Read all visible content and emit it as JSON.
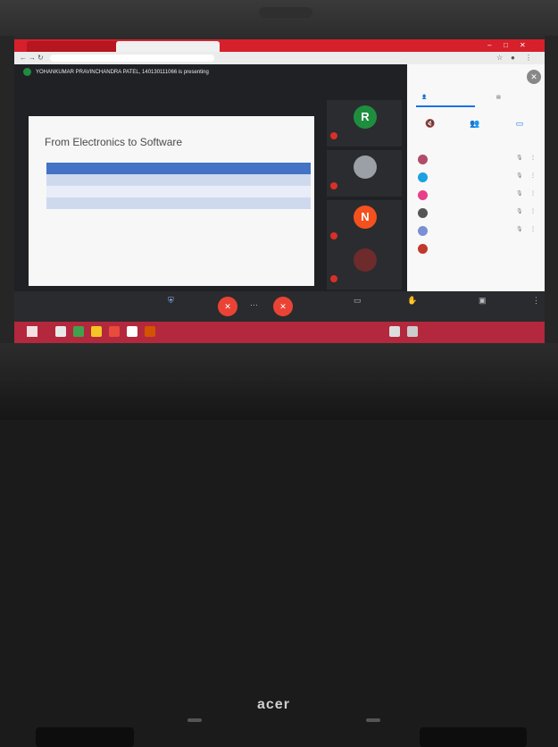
{
  "laptop": {
    "brand": "acer"
  },
  "browser": {
    "tabs": [
      "",
      ""
    ],
    "url": ""
  },
  "meet": {
    "presenter_banner": "YOHANKUMAR PRAVINCHANDRA PATEL, 140130111066 is presenting",
    "meeting_name": "",
    "slide": {
      "title": "From Electronics to Software",
      "table_headers": [
        "",
        ""
      ],
      "rows": [
        [
          "",
          ""
        ],
        [
          "",
          ""
        ],
        [
          "",
          ""
        ]
      ],
      "body_lines": [
        "",
        "",
        ""
      ]
    },
    "tiles": [
      {
        "initial": "R",
        "color": "#1e8e3e",
        "name": ""
      },
      {
        "initial": "",
        "color": "#9aa0a6",
        "name": ""
      },
      {
        "initial": "N",
        "color": "#f4511e",
        "name": ""
      },
      {
        "initial": "",
        "color": "#6d2b2b",
        "name": ""
      }
    ]
  },
  "panel": {
    "title": "",
    "tabs": [
      "",
      ""
    ],
    "actions": [
      "",
      "",
      ""
    ],
    "section": "",
    "people": [
      {
        "name": "",
        "color": "#b04d6a"
      },
      {
        "name": "",
        "color": "#1ba1e2"
      },
      {
        "name": "",
        "color": "#e83e8c"
      },
      {
        "name": "",
        "color": "#555555"
      },
      {
        "name": "",
        "color": "#7b8fd4"
      },
      {
        "name": "",
        "color": "#c0392b"
      }
    ]
  },
  "callbar": {
    "labels": [
      "",
      "",
      ""
    ]
  },
  "colors": {
    "accent": "#1a73e8",
    "end_call": "#ea4335",
    "taskbar": "#b3283c",
    "browser_tab": "#d6202b"
  }
}
